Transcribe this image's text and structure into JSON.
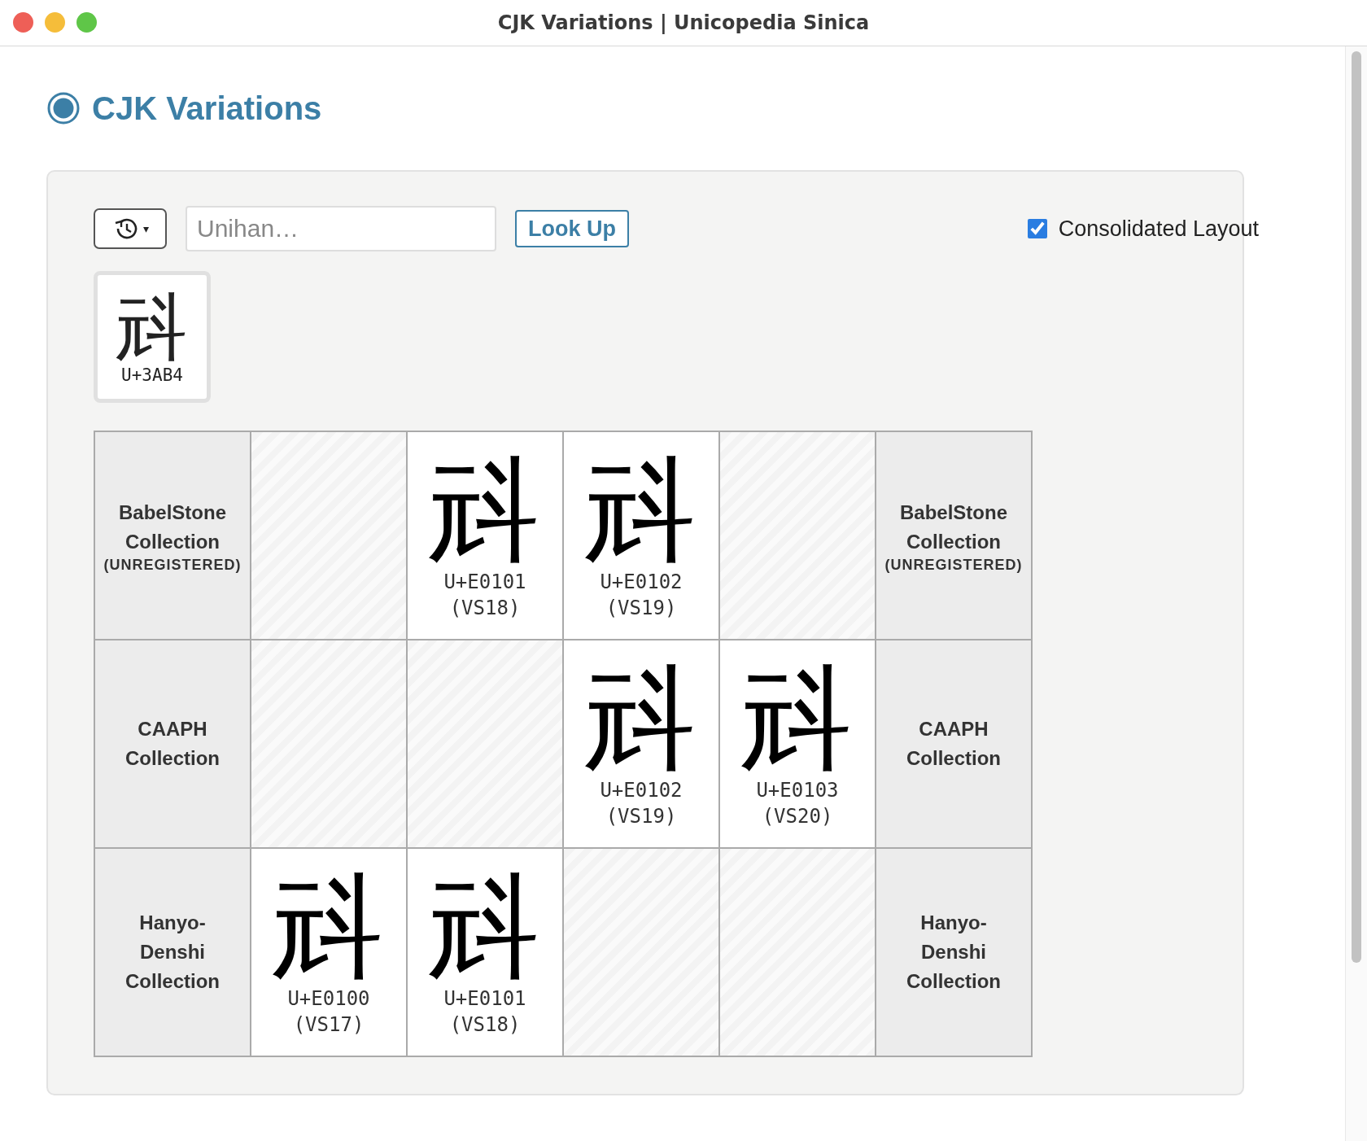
{
  "window": {
    "title": "CJK Variations | Unicopedia Sinica"
  },
  "heading": "CJK Variations",
  "toolbar": {
    "history_button": "▾",
    "input": {
      "placeholder": "Unihan…"
    },
    "lookup_button": "Look Up",
    "consolidated": {
      "label": "Consolidated Layout",
      "checked": true
    }
  },
  "character": {
    "glyph": "㪴",
    "code": "U+3AB4"
  },
  "rows": [
    {
      "label": "BabelStone Collection",
      "note": "(UNREGISTERED)",
      "cells": [
        null,
        {
          "glyph": "㪴",
          "code": "U+E0101",
          "vs": "(VS18)"
        },
        {
          "glyph": "㪴",
          "code": "U+E0102",
          "vs": "(VS19)"
        },
        null
      ],
      "label_right": "BabelStone Collection",
      "note_right": "(UNREGISTERED)"
    },
    {
      "label": "CAAPH Collection",
      "cells": [
        null,
        null,
        {
          "glyph": "㪴",
          "code": "U+E0102",
          "vs": "(VS19)"
        },
        {
          "glyph": "㪴",
          "code": "U+E0103",
          "vs": "(VS20)"
        }
      ],
      "label_right": "CAAPH Collection"
    },
    {
      "label": "Hanyo-Denshi Collection",
      "cells": [
        {
          "glyph": "㪴",
          "code": "U+E0100",
          "vs": "(VS17)"
        },
        {
          "glyph": "㪴",
          "code": "U+E0101",
          "vs": "(VS18)"
        },
        null,
        null
      ],
      "label_right": "Hanyo-Denshi Collection"
    }
  ]
}
